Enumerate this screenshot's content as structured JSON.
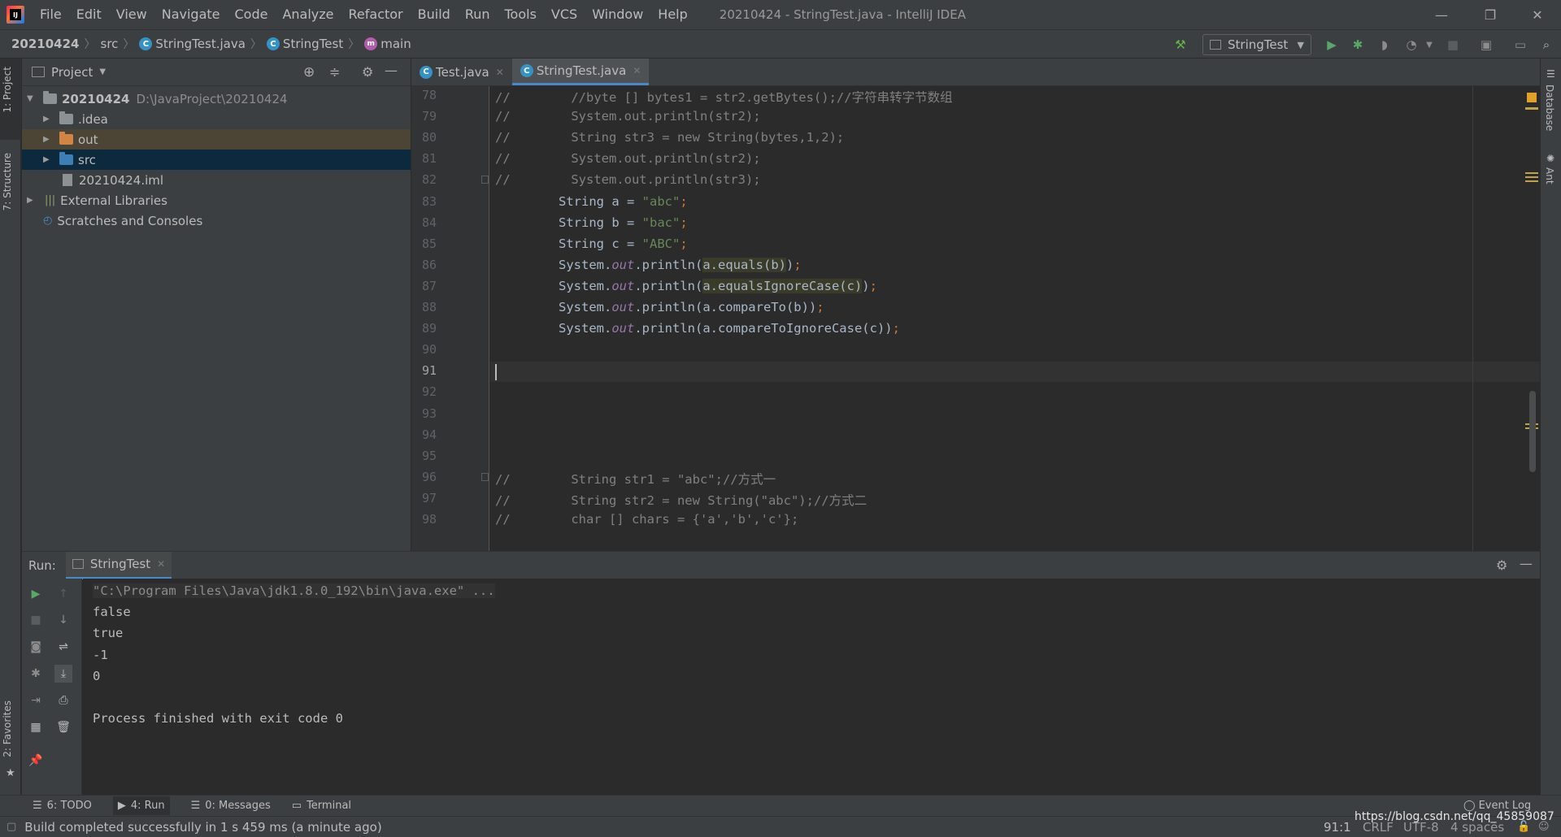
{
  "app": {
    "logo_text": "IJ",
    "title": "20210424 - StringTest.java - IntelliJ IDEA"
  },
  "menu": [
    "File",
    "Edit",
    "View",
    "Navigate",
    "Code",
    "Analyze",
    "Refactor",
    "Build",
    "Run",
    "Tools",
    "VCS",
    "Window",
    "Help"
  ],
  "breadcrumb": {
    "project": "20210424",
    "folder": "src",
    "file": "StringTest.java",
    "class": "StringTest",
    "method": "main"
  },
  "toolbar": {
    "run_config": "StringTest"
  },
  "project_panel": {
    "title": "Project",
    "tree": [
      {
        "label": "20210424",
        "extra": "D:\\JavaProject\\20210424"
      },
      {
        "label": ".idea"
      },
      {
        "label": "out"
      },
      {
        "label": "src"
      },
      {
        "label": "20210424.iml"
      },
      {
        "label": "External Libraries"
      },
      {
        "label": "Scratches and Consoles"
      }
    ]
  },
  "side_tabs": {
    "project": "1: Project",
    "structure": "7: Structure",
    "favorites": "2: Favorites",
    "database": "Database",
    "ant": "Ant"
  },
  "editor": {
    "tabs": [
      "Test.java",
      "StringTest.java"
    ],
    "lines": [
      {
        "no": "78",
        "text": "//        //byte [] bytes1 = str2.getBytes();//字符串转字节数组"
      },
      {
        "no": "79",
        "text": "//        System.out.println(str2);"
      },
      {
        "no": "80",
        "text": "//        String str3 = new String(bytes,1,2);"
      },
      {
        "no": "81",
        "text": "//        System.out.println(str2);"
      },
      {
        "no": "82",
        "text": "//        System.out.println(str3);"
      },
      {
        "no": "83",
        "k": "String a = ",
        "s": "\"abc\"",
        "e": ";"
      },
      {
        "no": "84",
        "k": "String b = ",
        "s": "\"bac\"",
        "e": ";"
      },
      {
        "no": "85",
        "k": "String c = ",
        "s": "\"ABC\"",
        "e": ";"
      },
      {
        "no": "86",
        "pre": "System.",
        "f": "out",
        "mid": ".println(",
        "h": "a.equals(b)",
        "e": ")",
        "semi": ";"
      },
      {
        "no": "87",
        "pre": "System.",
        "f": "out",
        "mid": ".println(",
        "h": "a.equalsIgnoreCase(c)",
        "e": ")",
        "semi": ";"
      },
      {
        "no": "88",
        "pre": "System.",
        "f": "out",
        "mid": ".println(a.compareTo(b))",
        "semi": ";"
      },
      {
        "no": "89",
        "pre": "System.",
        "f": "out",
        "mid": ".println(a.compareToIgnoreCase(c))",
        "semi": ";"
      },
      {
        "no": "90"
      },
      {
        "no": "91"
      },
      {
        "no": "92"
      },
      {
        "no": "93"
      },
      {
        "no": "94"
      },
      {
        "no": "95"
      },
      {
        "no": "96",
        "text": "//        String str1 = \"abc\";//方式一"
      },
      {
        "no": "97",
        "text": "//        String str2 = new String(\"abc\");//方式二"
      },
      {
        "no": "98",
        "text": "//        char [] chars = {'a','b','c'};"
      }
    ]
  },
  "run_panel": {
    "label": "Run:",
    "tab": "StringTest",
    "output": [
      "\"C:\\Program Files\\Java\\jdk1.8.0_192\\bin\\java.exe\" ...",
      "false",
      "true",
      "-1",
      "0",
      "",
      "Process finished with exit code 0"
    ]
  },
  "bottom_tabs": [
    "6: TODO",
    "4: Run",
    "0: Messages",
    "Terminal"
  ],
  "event_log": "Event Log",
  "status": {
    "message": "Build completed successfully in 1 s 459 ms (a minute ago)",
    "position": "91:1",
    "line_sep": "CRLF",
    "encoding": "UTF-8",
    "indent": "4 spaces",
    "watermark": "https://blog.csdn.net/qq_45859087"
  },
  "colors": {
    "keyword": "#cc7832",
    "string": "#6a8759",
    "field": "#9876aa",
    "comment": "#808080",
    "text": "#a9b7c6",
    "accent": "#4a88c7"
  }
}
